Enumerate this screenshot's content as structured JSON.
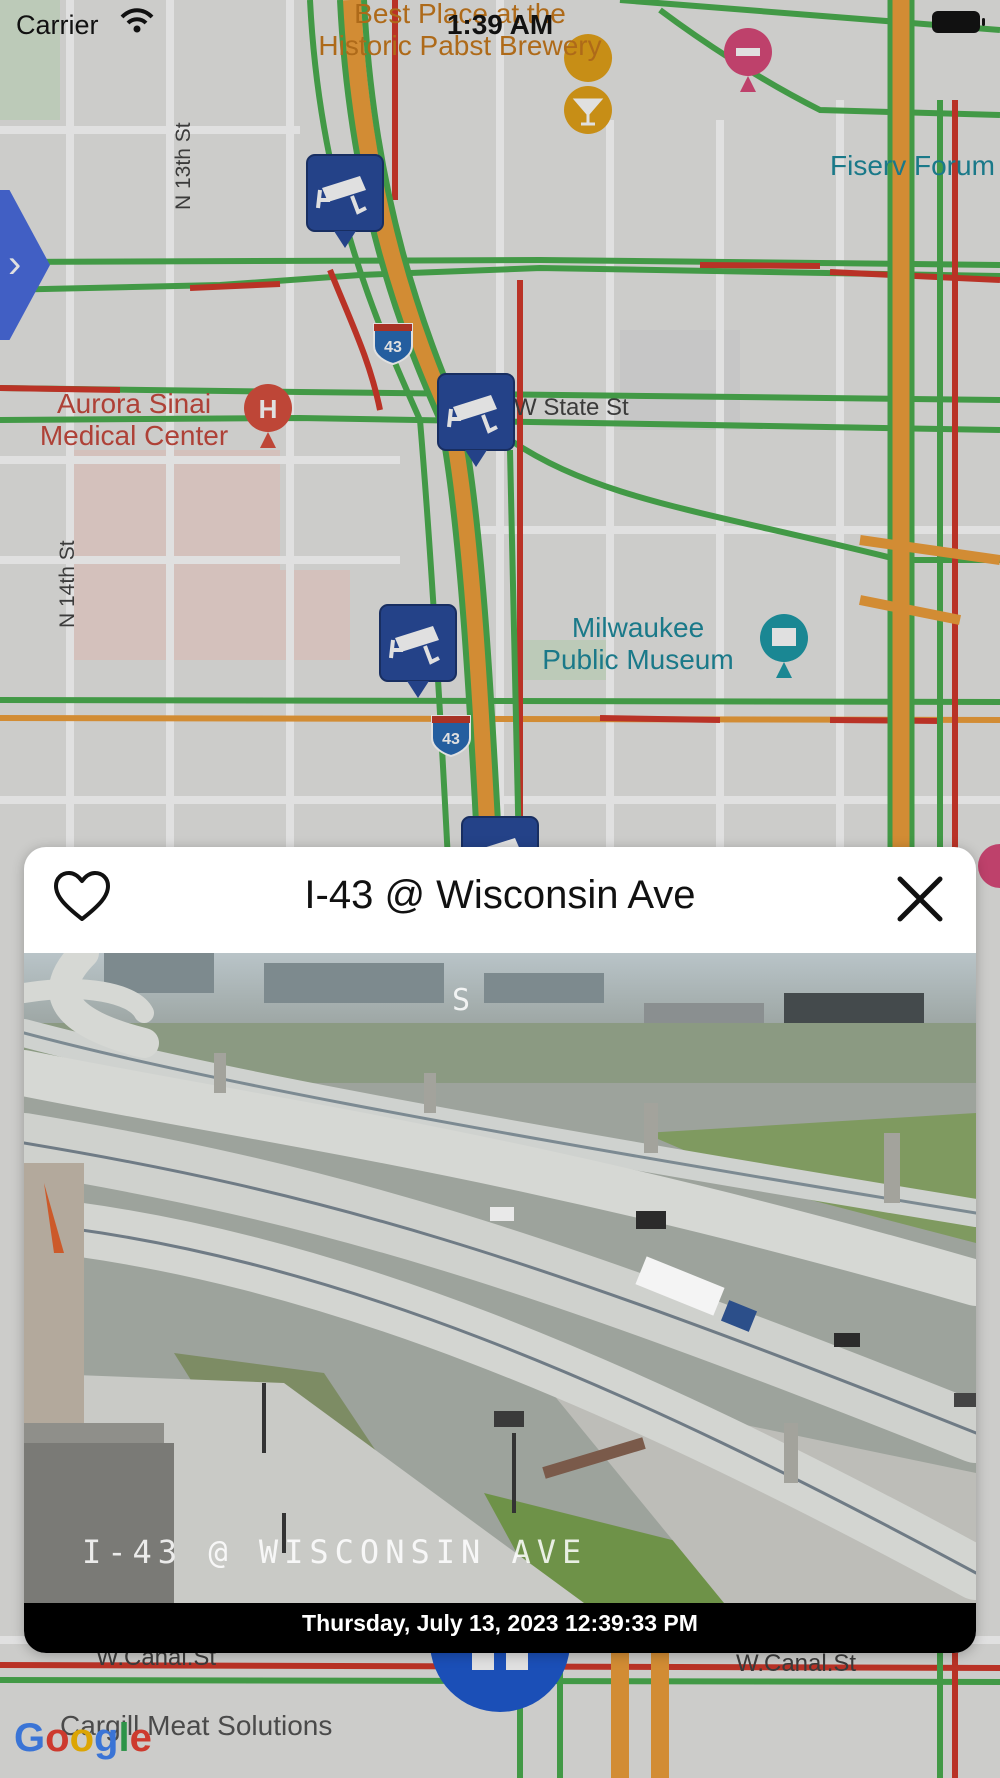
{
  "status_bar": {
    "carrier": "Carrier",
    "time": "1:39 AM"
  },
  "map": {
    "pois": [
      {
        "name": "Best Place at the\nHistoric Pabst Brewery",
        "color": "#c7791d"
      },
      {
        "name": "Fiserv Forum",
        "color": "#1e8a9c"
      },
      {
        "name": "Aurora Sinai\nMedical Center",
        "color": "#c74b3f"
      },
      {
        "name": "Milwaukee\nPublic Museum",
        "color": "#1e8a9c"
      },
      {
        "name": "Cargill Meat Solutions",
        "color": "#555555"
      }
    ],
    "streets": {
      "n13": "N 13th St",
      "n14": "N 14th St",
      "state": "W State St",
      "canal_left": "W.Canal.St",
      "canal_right": "W.Canal.St"
    },
    "shields": [
      "43",
      "43"
    ],
    "attribution": "Google"
  },
  "popup": {
    "title": "I-43 @ Wisconsin Ave",
    "camera_overlay": "I-43 @ WISCONSIN AVE",
    "direction": "S",
    "timestamp": "Thursday, July 13, 2023 12:39:33 PM"
  },
  "colors": {
    "accent": "#1f5bd1",
    "pin": "#2a4c9b",
    "traffic_green": "#4caf50",
    "traffic_orange": "#f0a03c",
    "traffic_red": "#d33a2c"
  }
}
